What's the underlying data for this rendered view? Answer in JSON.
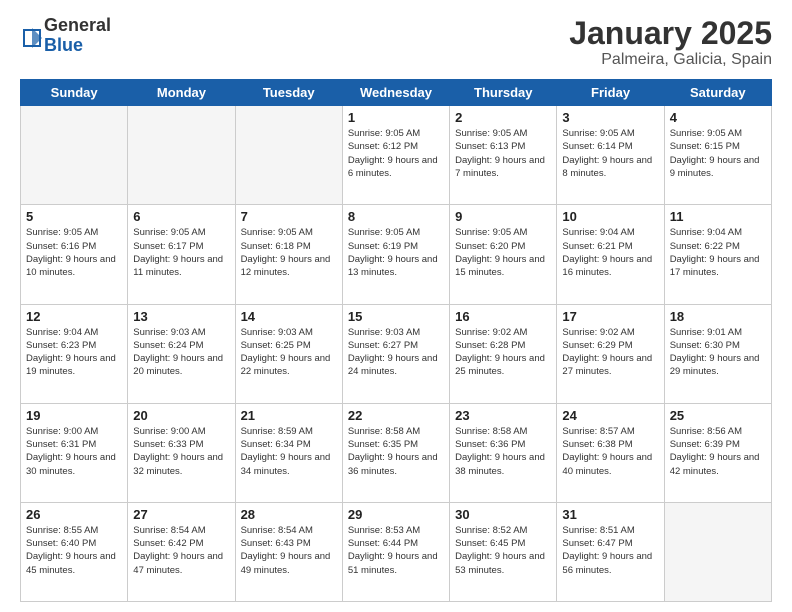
{
  "header": {
    "logo_line1": "General",
    "logo_line2": "Blue",
    "title": "January 2025",
    "subtitle": "Palmeira, Galicia, Spain"
  },
  "weekdays": [
    "Sunday",
    "Monday",
    "Tuesday",
    "Wednesday",
    "Thursday",
    "Friday",
    "Saturday"
  ],
  "weeks": [
    [
      {
        "day": "",
        "info": ""
      },
      {
        "day": "",
        "info": ""
      },
      {
        "day": "",
        "info": ""
      },
      {
        "day": "1",
        "info": "Sunrise: 9:05 AM\nSunset: 6:12 PM\nDaylight: 9 hours\nand 6 minutes."
      },
      {
        "day": "2",
        "info": "Sunrise: 9:05 AM\nSunset: 6:13 PM\nDaylight: 9 hours\nand 7 minutes."
      },
      {
        "day": "3",
        "info": "Sunrise: 9:05 AM\nSunset: 6:14 PM\nDaylight: 9 hours\nand 8 minutes."
      },
      {
        "day": "4",
        "info": "Sunrise: 9:05 AM\nSunset: 6:15 PM\nDaylight: 9 hours\nand 9 minutes."
      }
    ],
    [
      {
        "day": "5",
        "info": "Sunrise: 9:05 AM\nSunset: 6:16 PM\nDaylight: 9 hours\nand 10 minutes."
      },
      {
        "day": "6",
        "info": "Sunrise: 9:05 AM\nSunset: 6:17 PM\nDaylight: 9 hours\nand 11 minutes."
      },
      {
        "day": "7",
        "info": "Sunrise: 9:05 AM\nSunset: 6:18 PM\nDaylight: 9 hours\nand 12 minutes."
      },
      {
        "day": "8",
        "info": "Sunrise: 9:05 AM\nSunset: 6:19 PM\nDaylight: 9 hours\nand 13 minutes."
      },
      {
        "day": "9",
        "info": "Sunrise: 9:05 AM\nSunset: 6:20 PM\nDaylight: 9 hours\nand 15 minutes."
      },
      {
        "day": "10",
        "info": "Sunrise: 9:04 AM\nSunset: 6:21 PM\nDaylight: 9 hours\nand 16 minutes."
      },
      {
        "day": "11",
        "info": "Sunrise: 9:04 AM\nSunset: 6:22 PM\nDaylight: 9 hours\nand 17 minutes."
      }
    ],
    [
      {
        "day": "12",
        "info": "Sunrise: 9:04 AM\nSunset: 6:23 PM\nDaylight: 9 hours\nand 19 minutes."
      },
      {
        "day": "13",
        "info": "Sunrise: 9:03 AM\nSunset: 6:24 PM\nDaylight: 9 hours\nand 20 minutes."
      },
      {
        "day": "14",
        "info": "Sunrise: 9:03 AM\nSunset: 6:25 PM\nDaylight: 9 hours\nand 22 minutes."
      },
      {
        "day": "15",
        "info": "Sunrise: 9:03 AM\nSunset: 6:27 PM\nDaylight: 9 hours\nand 24 minutes."
      },
      {
        "day": "16",
        "info": "Sunrise: 9:02 AM\nSunset: 6:28 PM\nDaylight: 9 hours\nand 25 minutes."
      },
      {
        "day": "17",
        "info": "Sunrise: 9:02 AM\nSunset: 6:29 PM\nDaylight: 9 hours\nand 27 minutes."
      },
      {
        "day": "18",
        "info": "Sunrise: 9:01 AM\nSunset: 6:30 PM\nDaylight: 9 hours\nand 29 minutes."
      }
    ],
    [
      {
        "day": "19",
        "info": "Sunrise: 9:00 AM\nSunset: 6:31 PM\nDaylight: 9 hours\nand 30 minutes."
      },
      {
        "day": "20",
        "info": "Sunrise: 9:00 AM\nSunset: 6:33 PM\nDaylight: 9 hours\nand 32 minutes."
      },
      {
        "day": "21",
        "info": "Sunrise: 8:59 AM\nSunset: 6:34 PM\nDaylight: 9 hours\nand 34 minutes."
      },
      {
        "day": "22",
        "info": "Sunrise: 8:58 AM\nSunset: 6:35 PM\nDaylight: 9 hours\nand 36 minutes."
      },
      {
        "day": "23",
        "info": "Sunrise: 8:58 AM\nSunset: 6:36 PM\nDaylight: 9 hours\nand 38 minutes."
      },
      {
        "day": "24",
        "info": "Sunrise: 8:57 AM\nSunset: 6:38 PM\nDaylight: 9 hours\nand 40 minutes."
      },
      {
        "day": "25",
        "info": "Sunrise: 8:56 AM\nSunset: 6:39 PM\nDaylight: 9 hours\nand 42 minutes."
      }
    ],
    [
      {
        "day": "26",
        "info": "Sunrise: 8:55 AM\nSunset: 6:40 PM\nDaylight: 9 hours\nand 45 minutes."
      },
      {
        "day": "27",
        "info": "Sunrise: 8:54 AM\nSunset: 6:42 PM\nDaylight: 9 hours\nand 47 minutes."
      },
      {
        "day": "28",
        "info": "Sunrise: 8:54 AM\nSunset: 6:43 PM\nDaylight: 9 hours\nand 49 minutes."
      },
      {
        "day": "29",
        "info": "Sunrise: 8:53 AM\nSunset: 6:44 PM\nDaylight: 9 hours\nand 51 minutes."
      },
      {
        "day": "30",
        "info": "Sunrise: 8:52 AM\nSunset: 6:45 PM\nDaylight: 9 hours\nand 53 minutes."
      },
      {
        "day": "31",
        "info": "Sunrise: 8:51 AM\nSunset: 6:47 PM\nDaylight: 9 hours\nand 56 minutes."
      },
      {
        "day": "",
        "info": ""
      }
    ]
  ]
}
